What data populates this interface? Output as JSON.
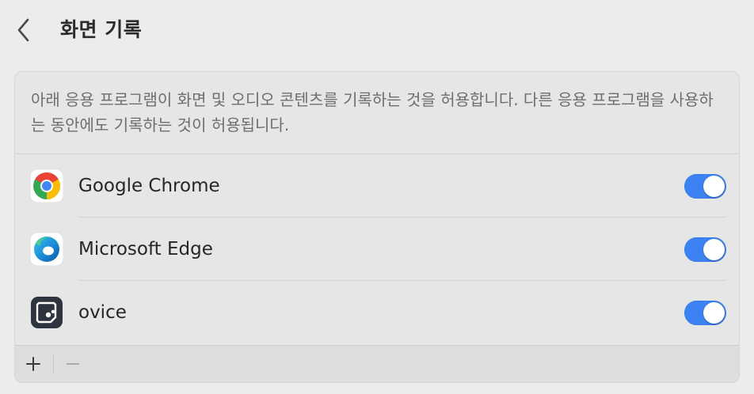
{
  "header": {
    "title": "화면 기록",
    "back_icon": "chevron-left-icon"
  },
  "description": "아래 응용 프로그램이 화면 및 오디오 콘텐츠를 기록하는 것을 허용합니다. 다른 응용 프로그램을 사용하는 동안에도 기록하는 것이 허용됩니다.",
  "apps": [
    {
      "name": "Google Chrome",
      "icon": "google-chrome-icon",
      "enabled": true
    },
    {
      "name": "Microsoft Edge",
      "icon": "microsoft-edge-icon",
      "enabled": true
    },
    {
      "name": "ovice",
      "icon": "ovice-icon",
      "enabled": true
    }
  ],
  "footer": {
    "add_icon": "plus-icon",
    "remove_icon": "minus-icon"
  },
  "colors": {
    "accent": "#3d82f2",
    "background": "#ececec",
    "panel": "#e6e6e6"
  }
}
